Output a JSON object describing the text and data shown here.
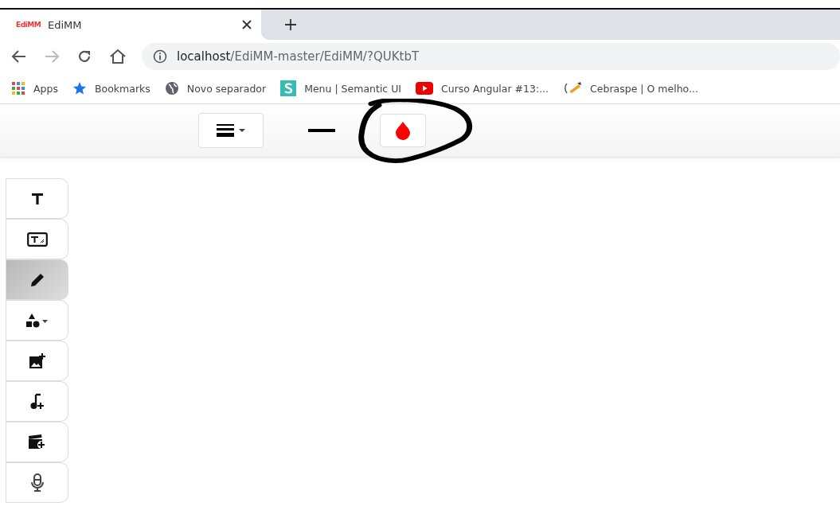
{
  "browser": {
    "tab": {
      "favicon": "EdiMM",
      "title": "EdiMM"
    },
    "navigation": {
      "back_disabled": false,
      "forward_disabled": true
    },
    "address": {
      "host": "localhost",
      "path": "/EdiMM-master/EdiMM/?QUKtbT"
    },
    "bookmarks": [
      {
        "kind": "apps",
        "label": "Apps"
      },
      {
        "kind": "star",
        "label": "Bookmarks"
      },
      {
        "kind": "globe",
        "label": "Novo separador"
      },
      {
        "kind": "semantic",
        "label": "Menu | Semantic UI"
      },
      {
        "kind": "youtube",
        "label": "Curso Angular #13:..."
      },
      {
        "kind": "pen",
        "label": "Cebraspe | O melho..."
      }
    ]
  },
  "toolbar": {
    "color": "#ff0000"
  },
  "tools": [
    {
      "kind": "text",
      "selected": false
    },
    {
      "kind": "textbox",
      "selected": false
    },
    {
      "kind": "pencil",
      "selected": true
    },
    {
      "kind": "shapes",
      "selected": false
    },
    {
      "kind": "image",
      "selected": false
    },
    {
      "kind": "audio",
      "selected": false
    },
    {
      "kind": "video",
      "selected": false
    },
    {
      "kind": "mic",
      "selected": false
    }
  ]
}
